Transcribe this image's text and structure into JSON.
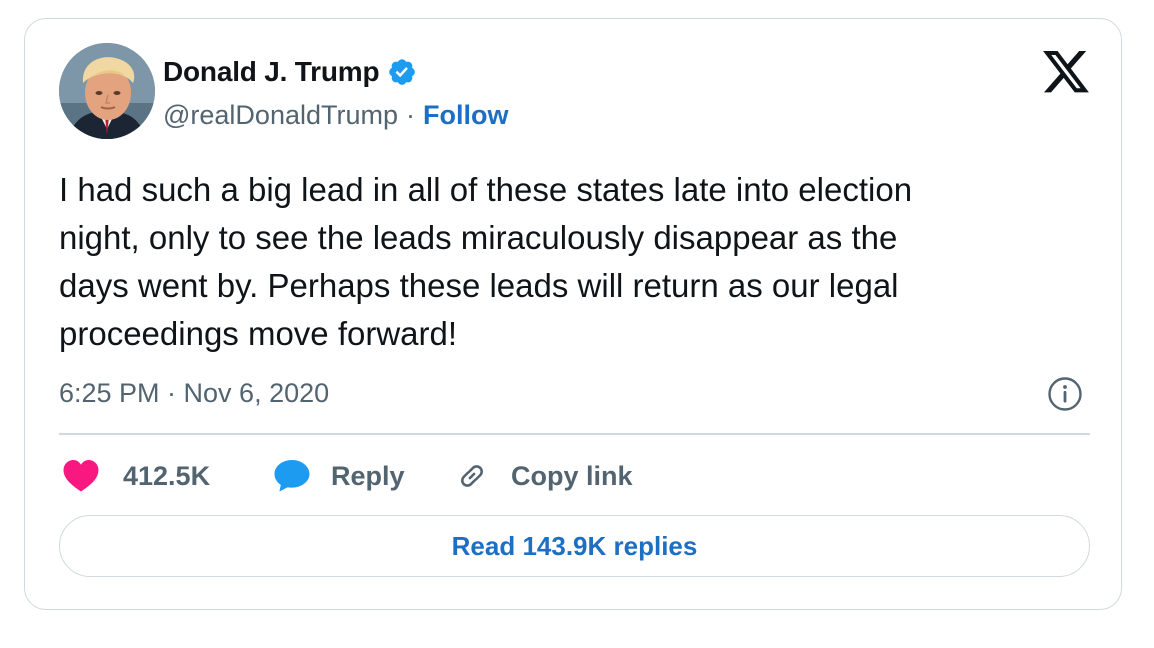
{
  "author": {
    "display_name": "Donald J. Trump",
    "handle": "@realDonaldTrump",
    "separator": "·",
    "follow_label": "Follow",
    "verified": true
  },
  "tweet": {
    "lines": [
      "I had such a big lead in all of these states late into election",
      "night, only to see the leads miraculously disappear as the",
      "days went by. Perhaps these leads will return as our legal",
      "proceedings move forward!"
    ],
    "timestamp": "6:25 PM · Nov 6, 2020"
  },
  "actions": {
    "like_count": "412.5K",
    "reply_label": "Reply",
    "copy_link_label": "Copy link"
  },
  "read_replies_label": "Read 143.9K replies",
  "icons": {
    "verified": "verified-badge-icon",
    "platform": "x-logo-icon",
    "info": "info-icon",
    "like": "heart-icon",
    "reply": "speech-bubble-icon",
    "copy": "link-icon"
  },
  "colors": {
    "accent": "#1d6fc4",
    "verified": "#1d9bf0",
    "like": "#f91880",
    "text": "#0f1419",
    "secondary": "#536471",
    "border": "#cfd9de"
  }
}
